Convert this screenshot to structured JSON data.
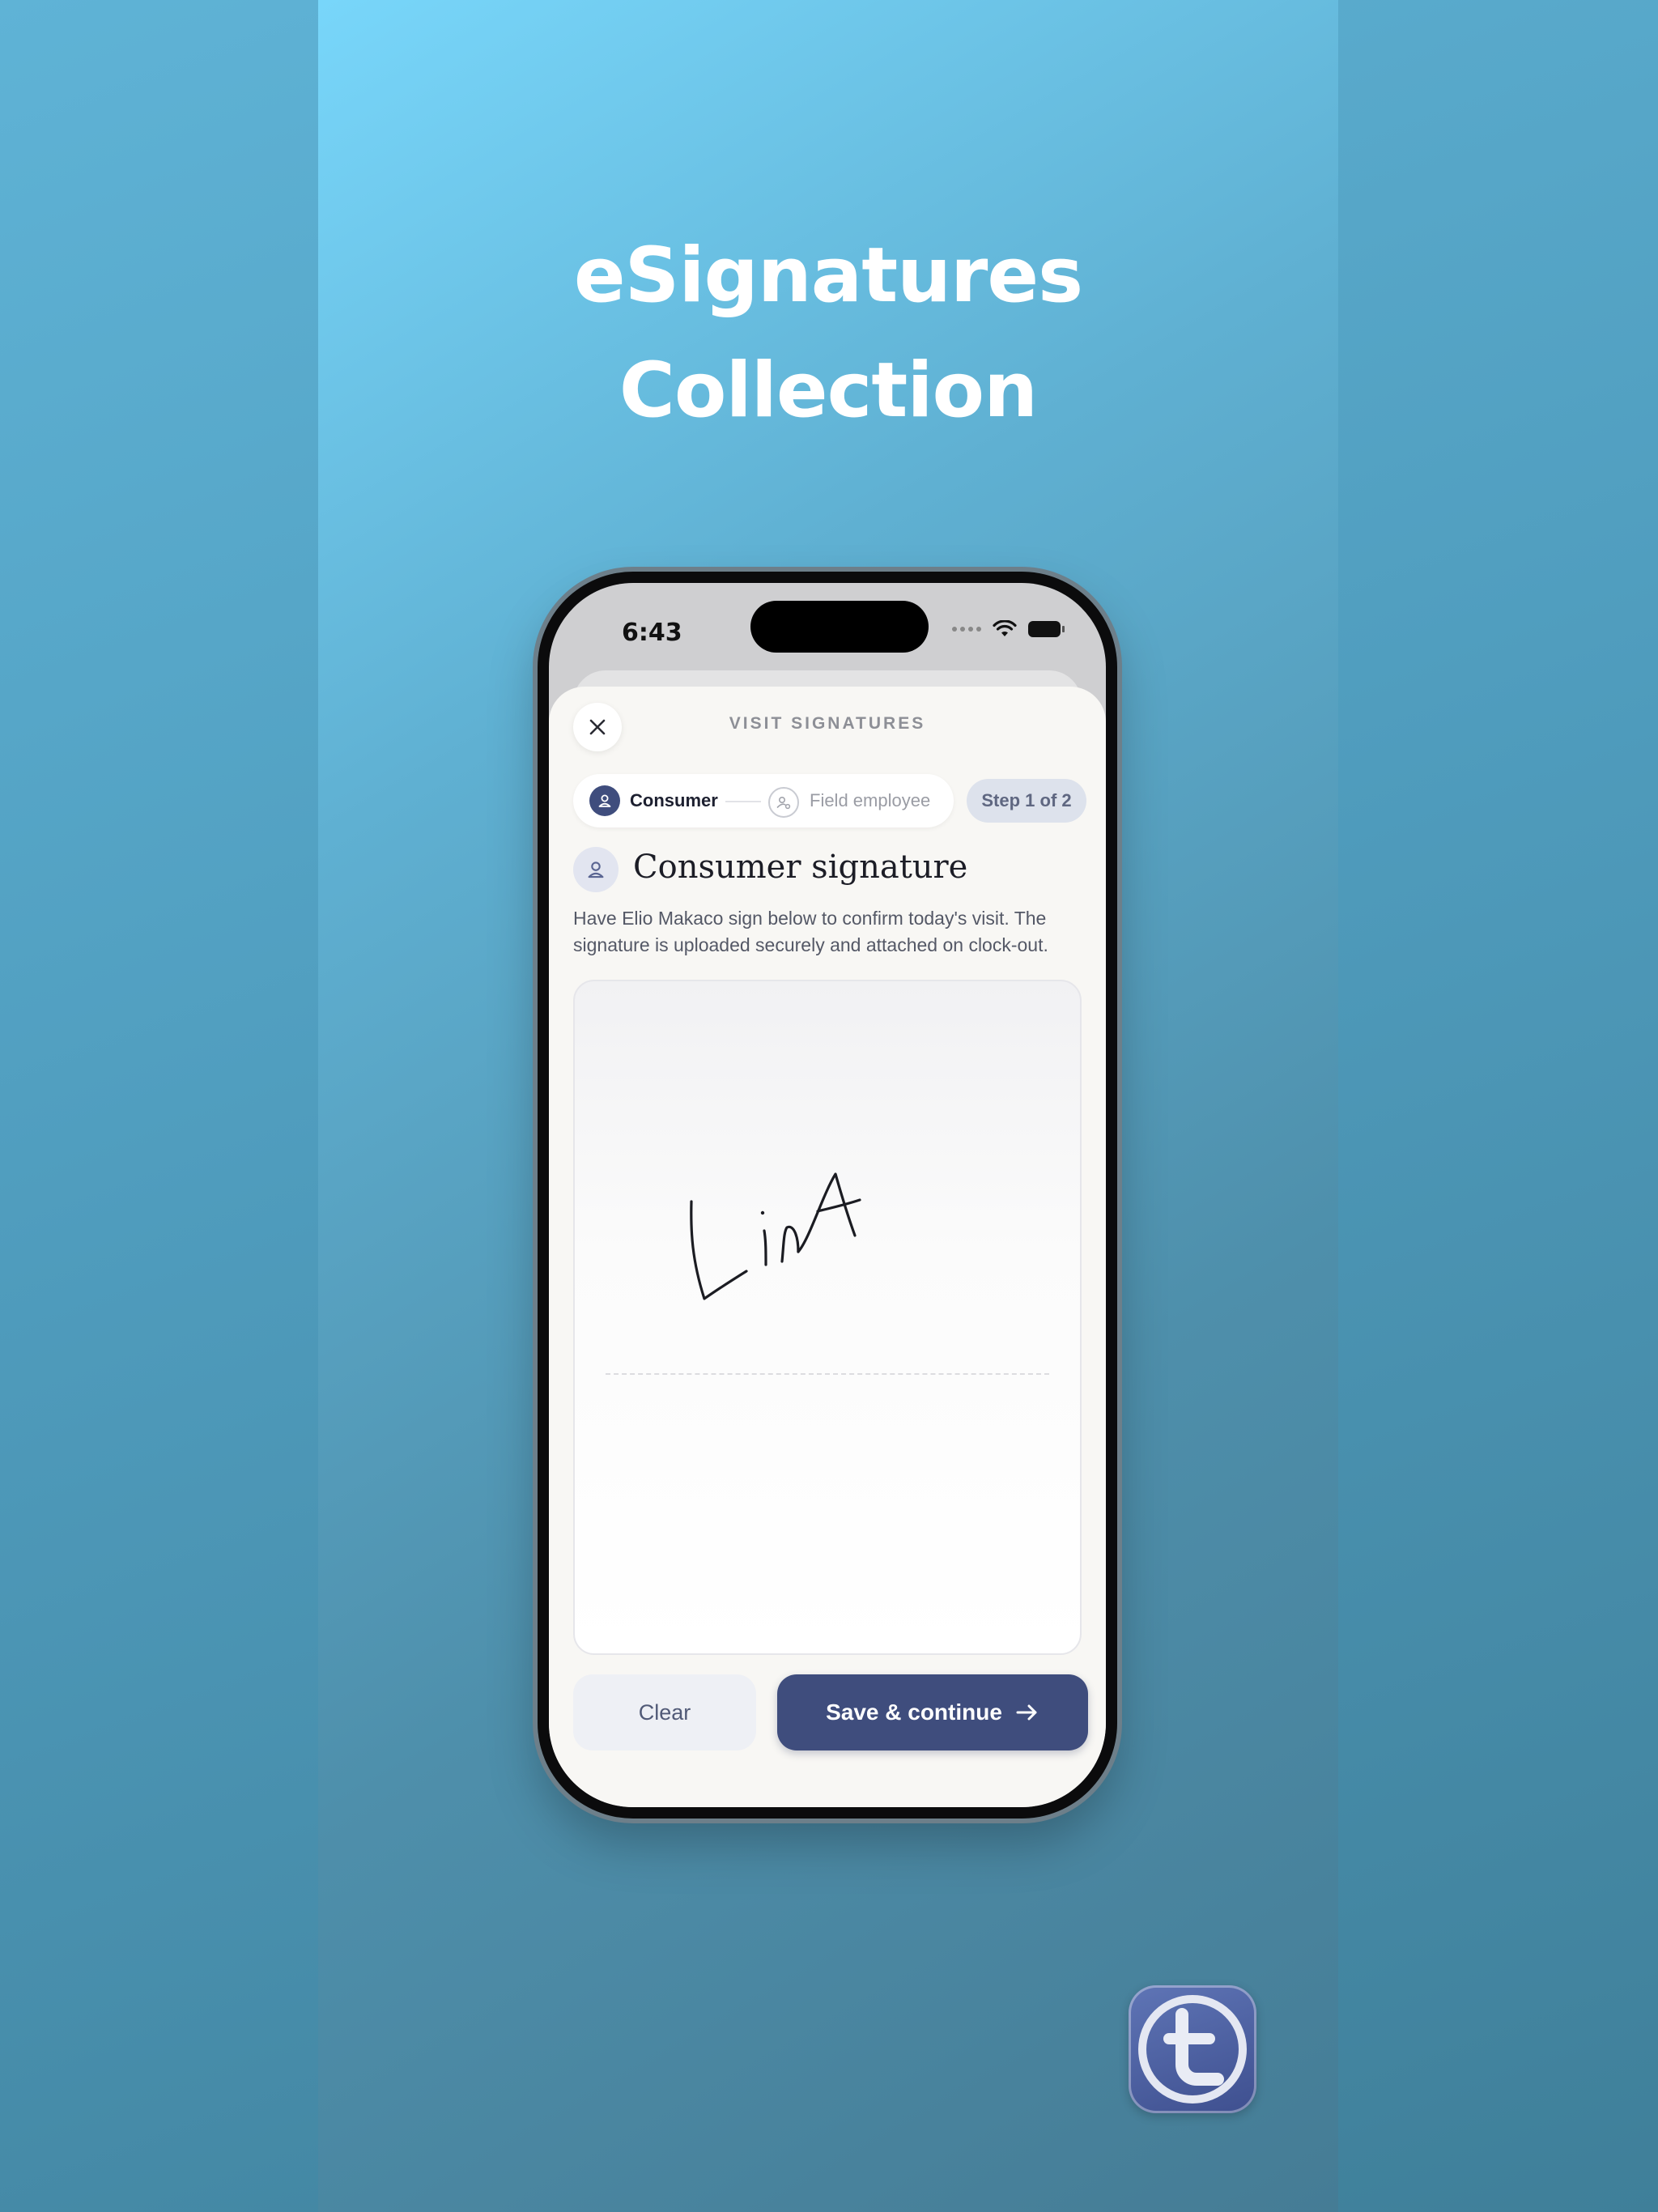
{
  "promo": {
    "headline_line1": "eSignatures",
    "headline_line2": "Collection"
  },
  "status_bar": {
    "time": "6:43"
  },
  "sheet": {
    "title": "VISIT SIGNATURES",
    "close_icon": "close-icon"
  },
  "stepper": {
    "steps": [
      {
        "label": "Consumer",
        "icon": "user-icon",
        "active": true
      },
      {
        "label": "Field employee",
        "icon": "user-cog-icon",
        "active": false
      }
    ],
    "step_count": "Step 1 of 2"
  },
  "signature": {
    "heading": "Consumer signature",
    "description": "Have Elio Makaco sign below to confirm today's visit. The signature is uploaded securely and attached on clock-out.",
    "drawn_text": "LinA"
  },
  "actions": {
    "clear_label": "Clear",
    "save_label": "Save & continue",
    "save_icon": "arrow-right-icon"
  },
  "colors": {
    "primary": "#3f4d7d",
    "sheet_bg": "#f8f7f4",
    "background_top": "#78d6fa",
    "background_bottom": "#457c95"
  }
}
